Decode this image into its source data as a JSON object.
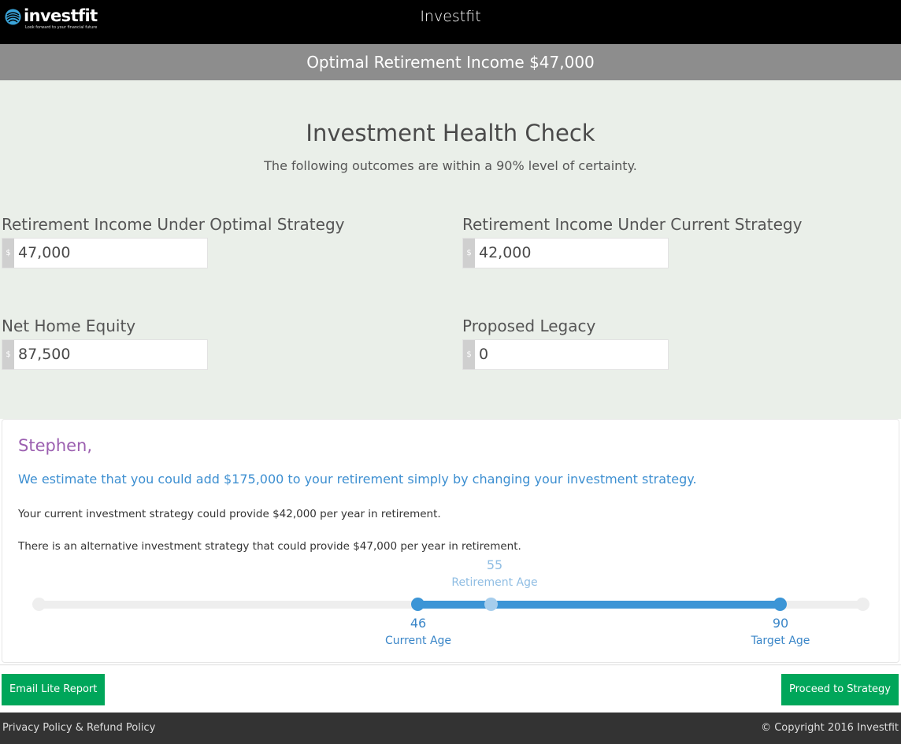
{
  "header": {
    "logo_word": "investfit",
    "logo_tagline": "Look forward to your financial future",
    "title": "Investfit"
  },
  "banner": {
    "text": "Optimal Retirement Income $47,000"
  },
  "health_check": {
    "title": "Investment Health Check",
    "subtitle": "The following outcomes are within a 90% level of certainty.",
    "currency_symbol": "$",
    "fields": [
      {
        "label": "Retirement Income Under Optimal Strategy",
        "value": "47,000"
      },
      {
        "label": "Retirement Income Under Current Strategy",
        "value": "42,000"
      },
      {
        "label": "Net Home Equity",
        "value": "87,500"
      },
      {
        "label": "Proposed Legacy",
        "value": "0"
      }
    ]
  },
  "summary": {
    "greeting": "Stephen,",
    "estimate": "We estimate that you could add $175,000 to your retirement simply by changing your investment strategy.",
    "current_text": "Your current investment strategy could provide $42,000 per year in retirement.",
    "alternative_text": "There is an alternative investment strategy that could provide $47,000 per year in retirement."
  },
  "age_slider": {
    "retirement_age": {
      "value": "55",
      "label": "Retirement Age"
    },
    "current_age": {
      "value": "46",
      "label": "Current Age"
    },
    "target_age": {
      "value": "90",
      "label": "Target Age"
    }
  },
  "actions": {
    "email_button": "Email Lite Report",
    "proceed_button": "Proceed to Strategy"
  },
  "footer": {
    "policy_link": "Privacy Policy & Refund Policy",
    "copyright": "© Copyright 2016 Investfit"
  },
  "colors": {
    "header_bg": "#000000",
    "banner_bg": "#8d8d8d",
    "section_bg": "#eaefe9",
    "greeting": "#9b5fb0",
    "accent_blue": "#3c95d6",
    "button_green": "#00a65a",
    "footer_bg": "#333333"
  }
}
